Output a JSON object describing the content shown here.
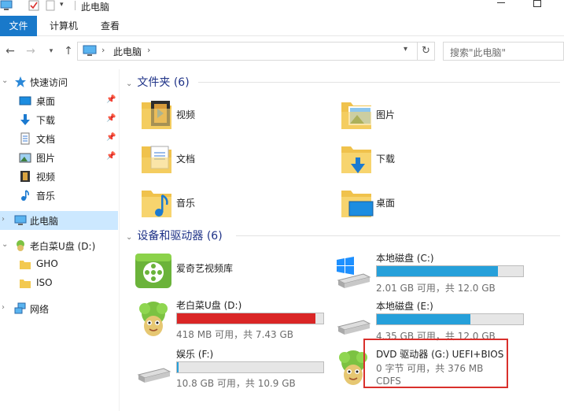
{
  "window": {
    "title": "此电脑"
  },
  "ribbon": {
    "tabs": [
      "文件",
      "计算机",
      "查看"
    ]
  },
  "address": {
    "crumb": "此电脑",
    "search_placeholder": "搜索\"此电脑\""
  },
  "sidebar": {
    "quick_access": "快速访问",
    "quick_items": [
      "桌面",
      "下载",
      "文档",
      "图片",
      "视频",
      "音乐"
    ],
    "this_pc": "此电脑",
    "usb_drive": "老白菜U盘 (D:)",
    "usb_children": [
      "GHO",
      "ISO"
    ],
    "network": "网络"
  },
  "folders": {
    "header": "文件夹 (6)",
    "items": [
      "视频",
      "图片",
      "文档",
      "下载",
      "音乐",
      "桌面"
    ]
  },
  "devices": {
    "header": "设备和驱动器 (6)",
    "items": [
      {
        "name": "爱奇艺视频库"
      },
      {
        "name": "本地磁盘 (C:)",
        "info": "2.01 GB 可用，共 12.0 GB",
        "used": 0.83,
        "color": "#26a0da"
      },
      {
        "name": "老白菜U盘 (D:)",
        "info": "418 MB 可用，共 7.43 GB",
        "used": 0.945,
        "color": "#da2626"
      },
      {
        "name": "本地磁盘 (E:)",
        "info": "4.35 GB 可用，共 12.0 GB",
        "used": 0.64,
        "color": "#26a0da"
      },
      {
        "name": "娱乐 (F:)",
        "info": "10.8 GB 可用，共 10.9 GB",
        "used": 0.01,
        "color": "#26a0da"
      },
      {
        "name": "DVD 驱动器 (G:) UEFI+BIOS",
        "info": "0 字节 可用，共 376 MB",
        "fs": "CDFS"
      }
    ]
  },
  "colors": {
    "accent": "#1979ca",
    "selected": "#cce8ff",
    "highlight": "#d9302c",
    "header": "#1e3287"
  }
}
